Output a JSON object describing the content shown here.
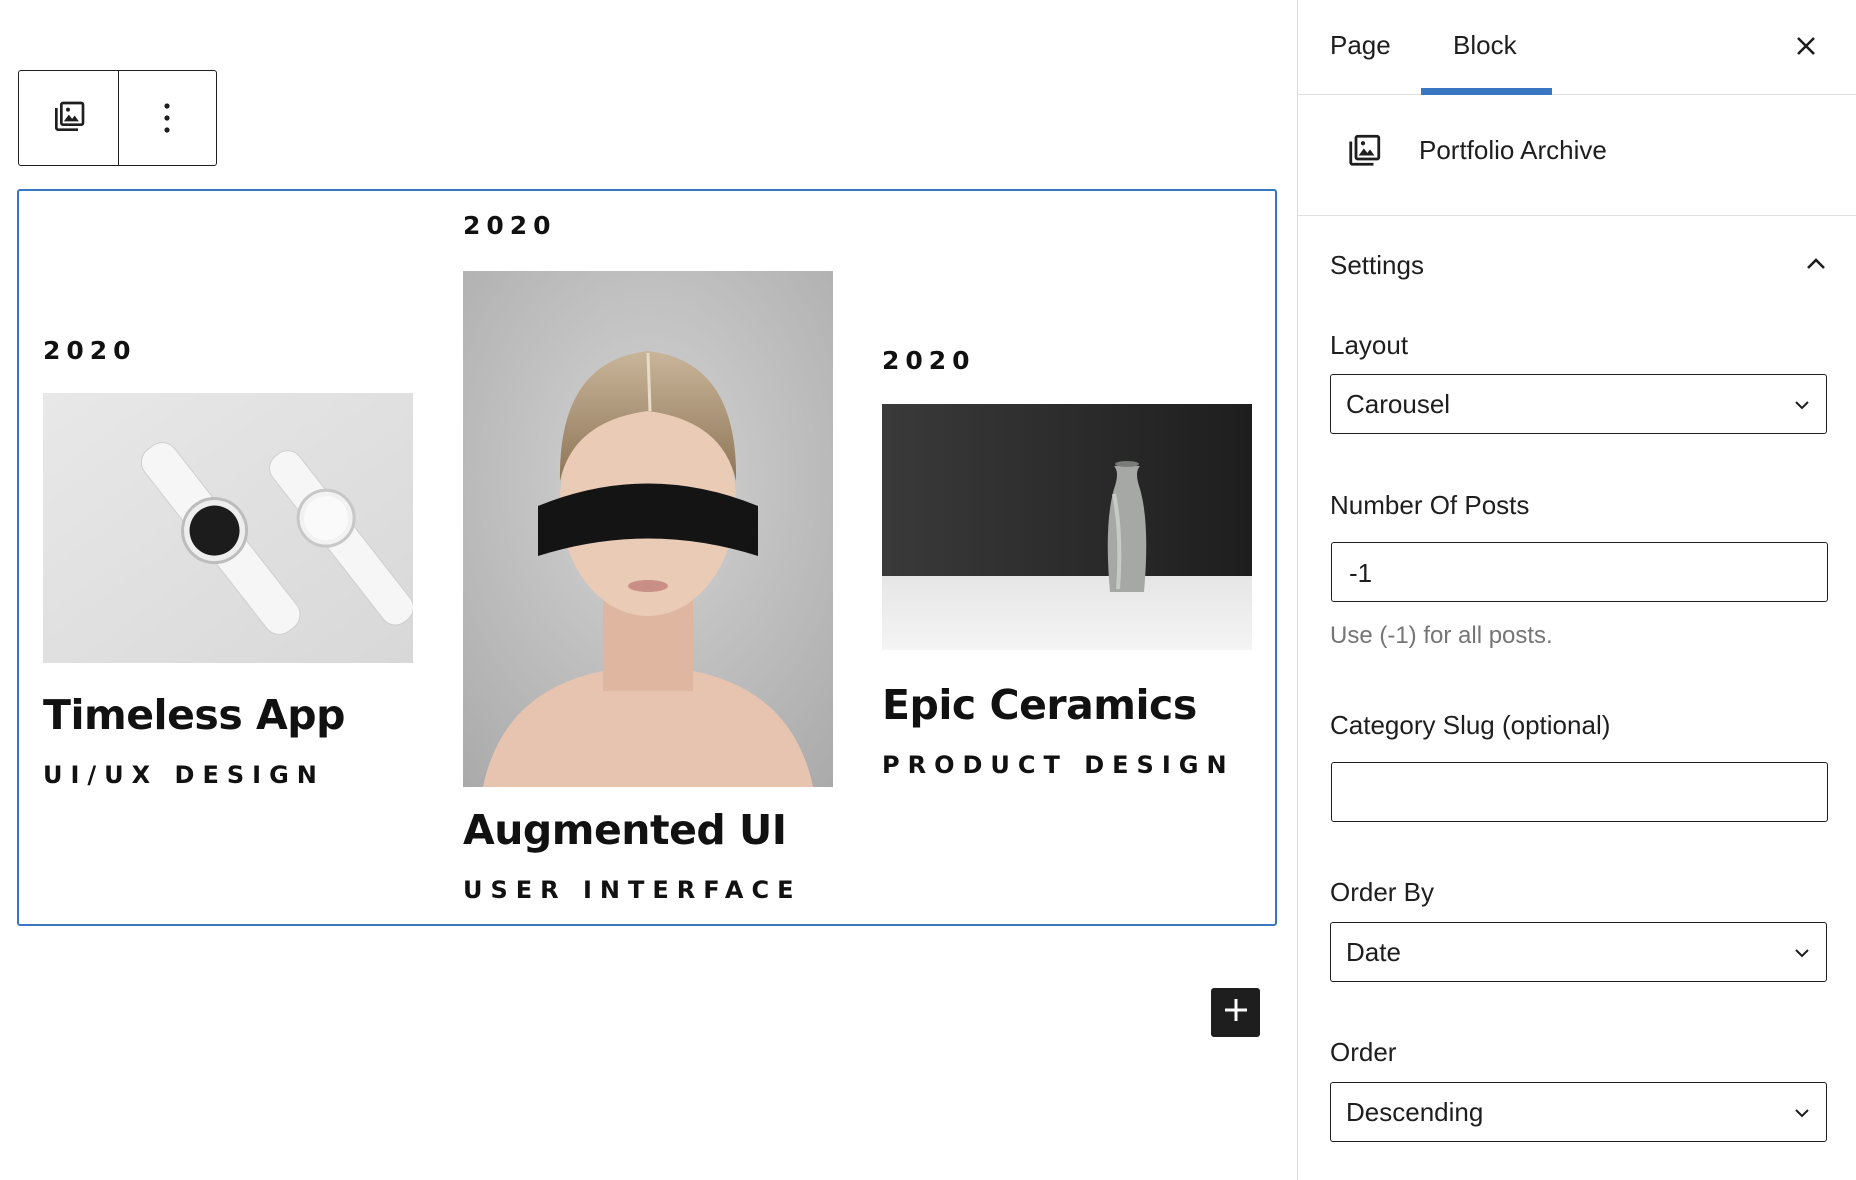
{
  "toolbar": {
    "block_icon": "gallery-icon",
    "more_icon": "more-vertical-icon"
  },
  "portfolio": {
    "items": [
      {
        "year": "2020",
        "title": "Timeless App",
        "category": "UI/UX DESIGN",
        "image": "white smartwatches"
      },
      {
        "year": "2020",
        "title": "Augmented UI",
        "category": "USER INTERFACE",
        "image": "woman with visor"
      },
      {
        "year": "2020",
        "title": "Epic Ceramics",
        "category": "PRODUCT DESIGN",
        "image": "ceramic vase"
      }
    ]
  },
  "inserter": {
    "icon": "plus-icon"
  },
  "sidebar": {
    "tabs": [
      "Page",
      "Block"
    ],
    "active_tab": "Block",
    "close_icon": "close-icon",
    "block_card": {
      "icon": "gallery-icon",
      "title": "Portfolio Archive"
    },
    "panel": {
      "title": "Settings",
      "chevron": "chevron-up-icon",
      "layout": {
        "label": "Layout",
        "value": "Carousel"
      },
      "number_of_posts": {
        "label": "Number Of Posts",
        "value": "-1",
        "help": "Use (-1) for all posts."
      },
      "category_slug": {
        "label": "Category Slug (optional)",
        "value": ""
      },
      "order_by": {
        "label": "Order By",
        "value": "Date"
      },
      "order": {
        "label": "Order",
        "value": "Descending"
      }
    }
  },
  "colors": {
    "accent": "#3a77c2",
    "text": "#1e1e1e",
    "help": "#757575",
    "border": "#dddddd"
  }
}
